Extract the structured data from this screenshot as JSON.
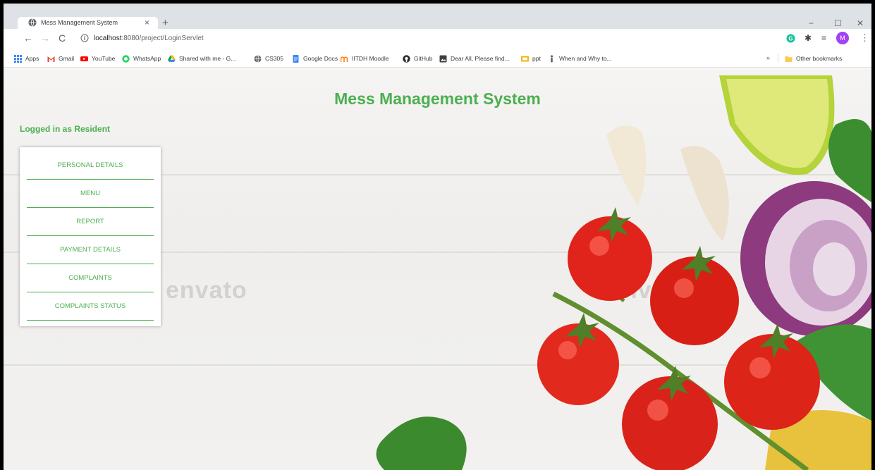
{
  "browser": {
    "tab": {
      "title": "Mess Management System",
      "close_glyph": "×"
    },
    "new_tab_glyph": "+",
    "window_controls": {
      "minimize": "−",
      "maximize": "☐",
      "close": "✕"
    },
    "nav": {
      "back": "←",
      "forward": "→",
      "reload": "C"
    },
    "url": {
      "host": "localhost",
      "rest": ":8080/project/LoginServlet"
    },
    "bookmark_star": "☆",
    "profile_initial": "M",
    "menu_glyph": "⋮",
    "bookmarks": [
      {
        "label": "Apps",
        "icon": "apps-grid-icon",
        "color": "#4285f4"
      },
      {
        "label": "Gmail",
        "icon": "gmail-icon",
        "color": "#ea4335"
      },
      {
        "label": "YouTube",
        "icon": "youtube-icon",
        "color": "#ff0000"
      },
      {
        "label": "WhatsApp",
        "icon": "whatsapp-icon",
        "color": "#25d366"
      },
      {
        "label": "Shared with me - G...",
        "icon": "google-drive-icon",
        "color": "#fbbc04"
      },
      {
        "label": "CS305",
        "icon": "globe-icon",
        "color": "#5f6368"
      },
      {
        "label": "Google Docs",
        "icon": "google-docs-icon",
        "color": "#4285f4"
      },
      {
        "label": "IITDH Moodle",
        "icon": "moodle-icon",
        "color": "#f98012"
      },
      {
        "label": "GitHub",
        "icon": "github-icon",
        "color": "#24292e"
      },
      {
        "label": "Dear All, Please find...",
        "icon": "doc-image-icon",
        "color": "#3c4043"
      },
      {
        "label": "ppt",
        "icon": "slides-icon",
        "color": "#f4b400"
      },
      {
        "label": "When and Why to...",
        "icon": "figure-icon",
        "color": "#5f6368"
      }
    ],
    "more_bookmarks": "»",
    "other_bookmarks": "Other bookmarks"
  },
  "page": {
    "title": "Mess Management System",
    "login_status": "Logged in as Resident",
    "watermark": "envato",
    "menu": [
      {
        "label": "PERSONAL DETAILS"
      },
      {
        "label": "MENU"
      },
      {
        "label": "REPORT"
      },
      {
        "label": "PAYMENT DETAILS"
      },
      {
        "label": "COMPLAINTS"
      },
      {
        "label": "COMPLAINTS STATUS"
      }
    ],
    "accent_color": "#4caf50"
  }
}
